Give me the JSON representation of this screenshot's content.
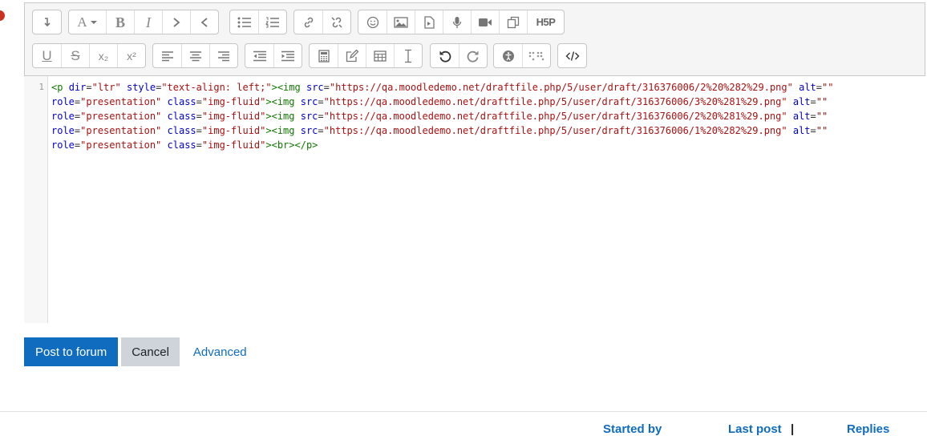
{
  "toolbar": {
    "row1": [
      {
        "name": "show-more-buttons-icon"
      },
      {
        "name": "paragraph-styles-icon"
      },
      {
        "name": "bold-icon",
        "glyph": "B"
      },
      {
        "name": "italic-icon",
        "glyph": "I"
      },
      {
        "name": "ltr-icon"
      },
      {
        "name": "rtl-icon"
      },
      {
        "name": "unordered-list-icon"
      },
      {
        "name": "ordered-list-icon"
      },
      {
        "name": "link-icon"
      },
      {
        "name": "unlink-icon"
      },
      {
        "name": "emoji-icon"
      },
      {
        "name": "image-icon"
      },
      {
        "name": "media-icon"
      },
      {
        "name": "record-audio-icon"
      },
      {
        "name": "record-video-icon"
      },
      {
        "name": "manage-files-icon"
      },
      {
        "name": "h5p-icon",
        "glyph": "H5P"
      }
    ],
    "row2": [
      {
        "name": "underline-icon",
        "glyph": "U"
      },
      {
        "name": "strikethrough-icon",
        "glyph": "S"
      },
      {
        "name": "subscript-icon",
        "glyph": "x₂"
      },
      {
        "name": "superscript-icon",
        "glyph": "x²"
      },
      {
        "name": "align-left-icon"
      },
      {
        "name": "align-center-icon"
      },
      {
        "name": "align-right-icon"
      },
      {
        "name": "outdent-icon"
      },
      {
        "name": "indent-icon"
      },
      {
        "name": "equation-icon"
      },
      {
        "name": "edit-icon"
      },
      {
        "name": "table-icon"
      },
      {
        "name": "clear-formatting-icon"
      },
      {
        "name": "undo-icon"
      },
      {
        "name": "redo-icon"
      },
      {
        "name": "accessibility-checker-icon"
      },
      {
        "name": "screenreader-helper-icon"
      },
      {
        "name": "html-source-icon"
      }
    ]
  },
  "editor": {
    "line_number": "1",
    "lines": [
      [
        [
          "tg",
          "<p "
        ],
        [
          "at",
          "dir"
        ],
        [
          "pl",
          "="
        ],
        [
          "st",
          "\"ltr\""
        ],
        [
          "pl",
          " "
        ],
        [
          "at",
          "style"
        ],
        [
          "pl",
          "="
        ],
        [
          "st",
          "\"text-align: left;\""
        ],
        [
          "tg",
          "><img "
        ],
        [
          "at",
          "src"
        ],
        [
          "pl",
          "="
        ],
        [
          "st",
          "\"https://qa.moodledemo.net/draftfile.php/5/user/draft/316376006/2%20%282%29.png\""
        ],
        [
          "pl",
          " "
        ],
        [
          "at",
          "alt"
        ],
        [
          "pl",
          "="
        ],
        [
          "st",
          "\"\""
        ]
      ],
      [
        [
          "at",
          "role"
        ],
        [
          "pl",
          "="
        ],
        [
          "st",
          "\"presentation\""
        ],
        [
          "pl",
          " "
        ],
        [
          "at",
          "class"
        ],
        [
          "pl",
          "="
        ],
        [
          "st",
          "\"img-fluid\""
        ],
        [
          "tg",
          "><img "
        ],
        [
          "at",
          "src"
        ],
        [
          "pl",
          "="
        ],
        [
          "st",
          "\"https://qa.moodledemo.net/draftfile.php/5/user/draft/316376006/3%20%281%29.png\""
        ],
        [
          "pl",
          " "
        ],
        [
          "at",
          "alt"
        ],
        [
          "pl",
          "="
        ],
        [
          "st",
          "\"\""
        ]
      ],
      [
        [
          "at",
          "role"
        ],
        [
          "pl",
          "="
        ],
        [
          "st",
          "\"presentation\""
        ],
        [
          "pl",
          " "
        ],
        [
          "at",
          "class"
        ],
        [
          "pl",
          "="
        ],
        [
          "st",
          "\"img-fluid\""
        ],
        [
          "tg",
          "><img "
        ],
        [
          "at",
          "src"
        ],
        [
          "pl",
          "="
        ],
        [
          "st",
          "\"https://qa.moodledemo.net/draftfile.php/5/user/draft/316376006/2%20%281%29.png\""
        ],
        [
          "pl",
          " "
        ],
        [
          "at",
          "alt"
        ],
        [
          "pl",
          "="
        ],
        [
          "st",
          "\"\""
        ]
      ],
      [
        [
          "at",
          "role"
        ],
        [
          "pl",
          "="
        ],
        [
          "st",
          "\"presentation\""
        ],
        [
          "pl",
          " "
        ],
        [
          "at",
          "class"
        ],
        [
          "pl",
          "="
        ],
        [
          "st",
          "\"img-fluid\""
        ],
        [
          "tg",
          "><img "
        ],
        [
          "at",
          "src"
        ],
        [
          "pl",
          "="
        ],
        [
          "st",
          "\"https://qa.moodledemo.net/draftfile.php/5/user/draft/316376006/1%20%282%29.png\""
        ],
        [
          "pl",
          " "
        ],
        [
          "at",
          "alt"
        ],
        [
          "pl",
          "="
        ],
        [
          "st",
          "\"\""
        ]
      ],
      [
        [
          "at",
          "role"
        ],
        [
          "pl",
          "="
        ],
        [
          "st",
          "\"presentation\""
        ],
        [
          "pl",
          " "
        ],
        [
          "at",
          "class"
        ],
        [
          "pl",
          "="
        ],
        [
          "st",
          "\"img-fluid\""
        ],
        [
          "tg",
          "><br></p>"
        ]
      ]
    ]
  },
  "actions": {
    "post_label": "Post to forum",
    "cancel_label": "Cancel",
    "advanced_label": "Advanced"
  },
  "table_header": {
    "started_by": "Started by",
    "last_post": "Last post",
    "replies": "Replies"
  },
  "colors": {
    "primary": "#0f6cbf",
    "required_dot": "#ca3120",
    "code_tag": "#117700",
    "code_attr": "#0000cc",
    "code_string": "#aa1111"
  }
}
